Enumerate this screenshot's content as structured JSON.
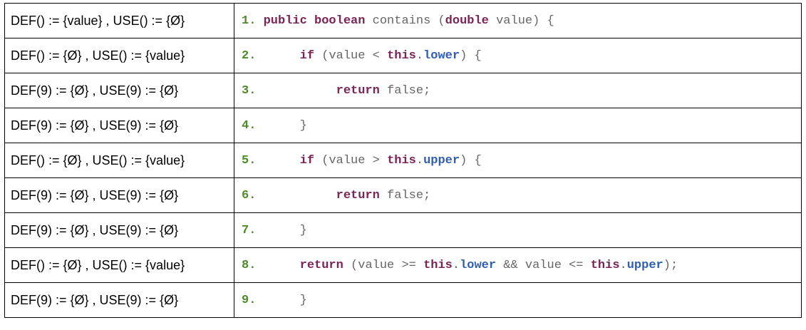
{
  "rows": [
    {
      "def": "DEF() := {value} , USE() := {Ø}",
      "code": [
        {
          "t": "1.",
          "c": "ln"
        },
        {
          "t": " ",
          "c": "txt"
        },
        {
          "t": "public",
          "c": "kw"
        },
        {
          "t": " ",
          "c": "txt"
        },
        {
          "t": "boolean",
          "c": "kw"
        },
        {
          "t": " contains (",
          "c": "txt"
        },
        {
          "t": "double",
          "c": "kw"
        },
        {
          "t": " value) {",
          "c": "txt"
        }
      ]
    },
    {
      "def": "DEF() := {Ø} , USE() := {value}",
      "code": [
        {
          "t": "2.",
          "c": "ln"
        },
        {
          "t": "      ",
          "c": "txt"
        },
        {
          "t": "if",
          "c": "kw"
        },
        {
          "t": " (value < ",
          "c": "txt"
        },
        {
          "t": "this",
          "c": "kw"
        },
        {
          "t": ".",
          "c": "txt"
        },
        {
          "t": "lower",
          "c": "fld"
        },
        {
          "t": ") {",
          "c": "txt"
        }
      ]
    },
    {
      "def": "DEF(9) := {Ø} , USE(9) := {Ø}",
      "code": [
        {
          "t": "3.",
          "c": "ln"
        },
        {
          "t": "           ",
          "c": "txt"
        },
        {
          "t": "return",
          "c": "kw"
        },
        {
          "t": " false;",
          "c": "txt"
        }
      ]
    },
    {
      "def": "DEF(9) := {Ø} , USE(9) := {Ø}",
      "code": [
        {
          "t": "4.",
          "c": "ln"
        },
        {
          "t": "      }",
          "c": "txt"
        }
      ]
    },
    {
      "def": "DEF() := {Ø} , USE() := {value}",
      "code": [
        {
          "t": "5.",
          "c": "ln"
        },
        {
          "t": "      ",
          "c": "txt"
        },
        {
          "t": "if",
          "c": "kw"
        },
        {
          "t": " (value > ",
          "c": "txt"
        },
        {
          "t": "this",
          "c": "kw"
        },
        {
          "t": ".",
          "c": "txt"
        },
        {
          "t": "upper",
          "c": "fld"
        },
        {
          "t": ") {",
          "c": "txt"
        }
      ]
    },
    {
      "def": "DEF(9) := {Ø} , USE(9) := {Ø}",
      "code": [
        {
          "t": "6.",
          "c": "ln"
        },
        {
          "t": "           ",
          "c": "txt"
        },
        {
          "t": "return",
          "c": "kw"
        },
        {
          "t": " false;",
          "c": "txt"
        }
      ]
    },
    {
      "def": "DEF(9) := {Ø} , USE(9) := {Ø}",
      "code": [
        {
          "t": "7.",
          "c": "ln"
        },
        {
          "t": "      }",
          "c": "txt"
        }
      ]
    },
    {
      "def": "DEF() := {Ø} , USE() := {value}",
      "code": [
        {
          "t": "8.",
          "c": "ln"
        },
        {
          "t": "      ",
          "c": "txt"
        },
        {
          "t": "return",
          "c": "kw"
        },
        {
          "t": " (value >= ",
          "c": "txt"
        },
        {
          "t": "this",
          "c": "kw"
        },
        {
          "t": ".",
          "c": "txt"
        },
        {
          "t": "lower",
          "c": "fld"
        },
        {
          "t": " && value <= ",
          "c": "txt"
        },
        {
          "t": "this",
          "c": "kw"
        },
        {
          "t": ".",
          "c": "txt"
        },
        {
          "t": "upper",
          "c": "fld"
        },
        {
          "t": ");",
          "c": "txt"
        }
      ]
    },
    {
      "def": "DEF(9) := {Ø} , USE(9) := {Ø}",
      "code": [
        {
          "t": "9.",
          "c": "ln"
        },
        {
          "t": "      }",
          "c": "txt"
        }
      ]
    }
  ],
  "colors": {
    "line_number": "#4d8a2a",
    "keyword": "#7b2456",
    "field": "#2f5fb3",
    "plain": "#666666"
  }
}
